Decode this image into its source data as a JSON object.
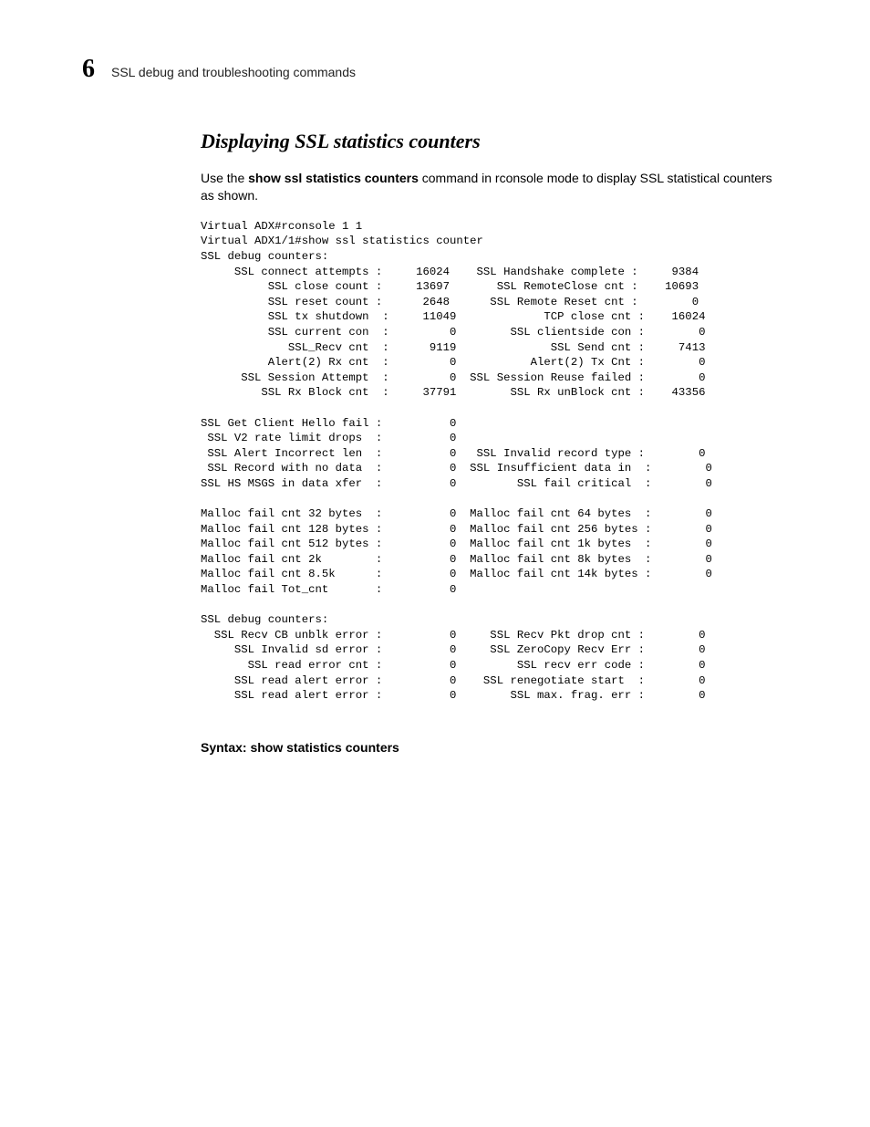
{
  "header": {
    "chapter_number": "6",
    "chapter_title": "SSL debug and troubleshooting commands"
  },
  "section": {
    "title": "Displaying SSL statistics counters",
    "intro_prefix": "Use the ",
    "intro_cmd": "show ssl statistics counters",
    "intro_suffix": " command in rconsole mode to display SSL statistical counters as shown."
  },
  "console": "Virtual ADX#rconsole 1 1\nVirtual ADX1/1#show ssl statistics counter\nSSL debug counters:\n     SSL connect attempts :     16024    SSL Handshake complete :     9384\n          SSL close count :     13697       SSL RemoteClose cnt :    10693\n          SSL reset count :      2648      SSL Remote Reset cnt :        0\n          SSL tx shutdown  :     11049             TCP close cnt :    16024\n          SSL current con  :         0        SSL clientside con :        0\n             SSL_Recv cnt  :      9119              SSL Send cnt :     7413\n          Alert(2) Rx cnt  :         0           Alert(2) Tx Cnt :        0\n      SSL Session Attempt  :         0  SSL Session Reuse failed :        0\n         SSL Rx Block cnt  :     37791        SSL Rx unBlock cnt :    43356\n\nSSL Get Client Hello fail :          0\n SSL V2 rate limit drops  :          0\n SSL Alert Incorrect len  :          0   SSL Invalid record type :        0\n SSL Record with no data  :          0  SSL Insufficient data in  :        0\nSSL HS MSGS in data xfer  :          0         SSL fail critical  :        0\n\nMalloc fail cnt 32 bytes  :          0  Malloc fail cnt 64 bytes  :        0\nMalloc fail cnt 128 bytes :          0  Malloc fail cnt 256 bytes :        0\nMalloc fail cnt 512 bytes :          0  Malloc fail cnt 1k bytes  :        0\nMalloc fail cnt 2k        :          0  Malloc fail cnt 8k bytes  :        0\nMalloc fail cnt 8.5k      :          0  Malloc fail cnt 14k bytes :        0\nMalloc fail Tot_cnt       :          0\n\nSSL debug counters:\n  SSL Recv CB unblk error :          0     SSL Recv Pkt drop cnt :        0\n     SSL Invalid sd error :          0     SSL ZeroCopy Recv Err :        0\n       SSL read error cnt :          0         SSL recv err code :        0\n     SSL read alert error :          0    SSL renegotiate start  :        0\n     SSL read alert error :          0        SSL max. frag. err :        0",
  "syntax": {
    "label": "Syntax:  ",
    "command": "show statistics counters"
  }
}
